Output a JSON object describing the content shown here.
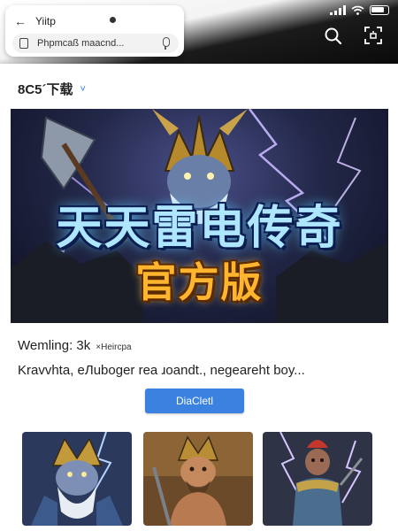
{
  "browser": {
    "tab_title": "Yiitp",
    "url_text": "Phpmcaß maacnd...",
    "back_icon": "back-arrow-icon",
    "mic_icon": "microphone-icon"
  },
  "status_bar": {
    "icons": [
      "signal-icon",
      "wifi-icon",
      "battery-icon"
    ]
  },
  "toolbar": {
    "search_icon": "search-icon",
    "scan_icon": "scan-icon"
  },
  "section": {
    "title": "8C5´下载",
    "chevron_icon": "chevron-icon"
  },
  "banner": {
    "title_main": "天天雷电传奇",
    "title_sub": "官方版"
  },
  "info": {
    "rating": "Wemling: 3k",
    "rating_note": "×Heircpa",
    "description": "Kravvhta, eЛuboger rea ɹoandt., negeareht boy..."
  },
  "download_button": {
    "label": "DiaCletl"
  },
  "thumbnails": [
    {
      "name": "armored-warrior"
    },
    {
      "name": "barbarian-warrior"
    },
    {
      "name": "red-haired-warrior"
    }
  ],
  "colors": {
    "accent": "#3b82e0",
    "banner_title": "#aee6ff",
    "banner_sub": "#ffb62e"
  }
}
